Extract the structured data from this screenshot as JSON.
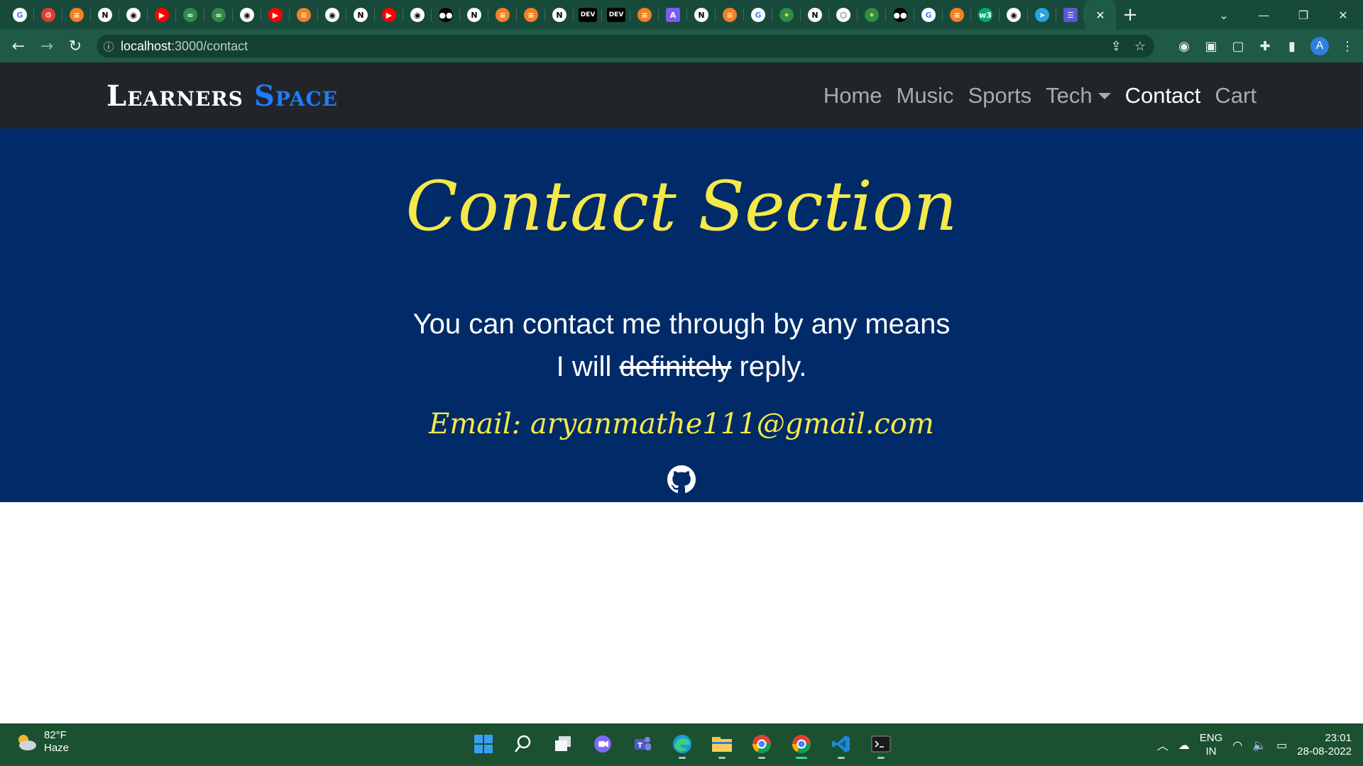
{
  "browser": {
    "url_host": "localhost",
    "url_path": ":3000/contact",
    "tabs": [
      {
        "icon": "google-icon"
      },
      {
        "icon": "settings-gear-icon"
      },
      {
        "icon": "stackoverflow-icon"
      },
      {
        "icon": "notion-icon"
      },
      {
        "icon": "github-icon"
      },
      {
        "icon": "youtube-icon"
      },
      {
        "icon": "geeksforgeeks-icon"
      },
      {
        "icon": "geeksforgeeks-icon"
      },
      {
        "icon": "github-icon"
      },
      {
        "icon": "youtube-icon"
      },
      {
        "icon": "stackoverflow-icon"
      },
      {
        "icon": "github-icon"
      },
      {
        "icon": "notion-icon"
      },
      {
        "icon": "youtube-icon"
      },
      {
        "icon": "github-icon"
      },
      {
        "icon": "medium-icon"
      },
      {
        "icon": "notion-icon"
      },
      {
        "icon": "stackoverflow-icon"
      },
      {
        "icon": "stackoverflow-icon"
      },
      {
        "icon": "notion-icon"
      },
      {
        "icon": "dev-icon",
        "text": "DEV"
      },
      {
        "icon": "dev-icon",
        "text": "DEV"
      },
      {
        "icon": "stackoverflow-icon"
      },
      {
        "icon": "app-icon"
      },
      {
        "icon": "notion-icon"
      },
      {
        "icon": "stackoverflow-icon"
      },
      {
        "icon": "google-icon"
      },
      {
        "icon": "sparkle-icon"
      },
      {
        "icon": "notion-icon"
      },
      {
        "icon": "cube-icon"
      },
      {
        "icon": "sparkle-icon"
      },
      {
        "icon": "medium-icon"
      },
      {
        "icon": "google-icon"
      },
      {
        "icon": "stackoverflow-icon"
      },
      {
        "icon": "w3schools-icon"
      },
      {
        "icon": "github-icon"
      },
      {
        "icon": "telegram-icon"
      },
      {
        "icon": "list-icon"
      }
    ],
    "active_tab_close": "✕",
    "new_tab": "+",
    "profile_initial": "A"
  },
  "site": {
    "brand_part1": "Learners",
    "brand_part2": "Space",
    "nav": [
      {
        "label": "Home"
      },
      {
        "label": "Music"
      },
      {
        "label": "Sports"
      },
      {
        "label": "Tech"
      },
      {
        "label": "Contact"
      },
      {
        "label": "Cart"
      }
    ],
    "active_nav": "Contact"
  },
  "hero": {
    "title": "Contact Section",
    "line1": "You can contact me through by any means",
    "line2_prefix": "I will",
    "line2_struck": "definitely",
    "line2_suffix": "reply.",
    "email": "Email: aryanmathe111@gmail.com",
    "github_icon": "github-icon"
  },
  "taskbar": {
    "weather_temp": "82°F",
    "weather_desc": "Haze",
    "lang_line1": "ENG",
    "lang_line2": "IN",
    "time": "23:01",
    "date": "28-08-2022"
  },
  "colors": {
    "tab_strip": "#174a3a",
    "navbar_bg": "#212529",
    "hero_bg": "#002a68",
    "title_yellow": "#f5e94a",
    "brand_blue": "#1e7dff",
    "taskbar_bg": "#1b5130"
  }
}
